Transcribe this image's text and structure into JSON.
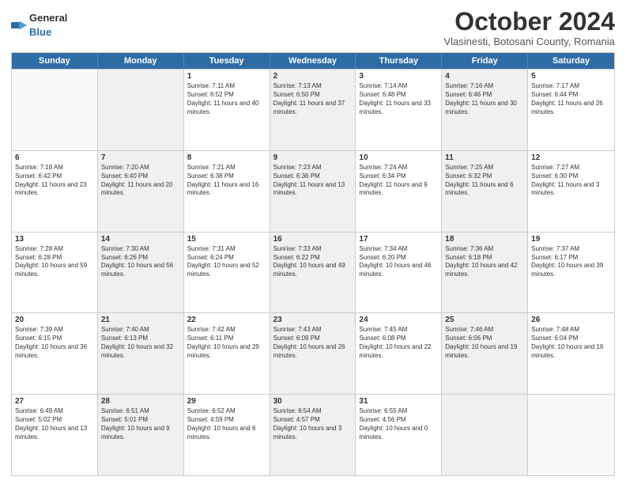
{
  "header": {
    "logo_general": "General",
    "logo_blue": "Blue",
    "month_title": "October 2024",
    "location": "Vlasinesti, Botosani County, Romania"
  },
  "days_of_week": [
    "Sunday",
    "Monday",
    "Tuesday",
    "Wednesday",
    "Thursday",
    "Friday",
    "Saturday"
  ],
  "weeks": [
    [
      {
        "day": "",
        "sunrise": "",
        "sunset": "",
        "daylight": "",
        "shaded": false,
        "empty": true
      },
      {
        "day": "",
        "sunrise": "",
        "sunset": "",
        "daylight": "",
        "shaded": true,
        "empty": true
      },
      {
        "day": "1",
        "sunrise": "Sunrise: 7:11 AM",
        "sunset": "Sunset: 6:52 PM",
        "daylight": "Daylight: 11 hours and 40 minutes.",
        "shaded": false
      },
      {
        "day": "2",
        "sunrise": "Sunrise: 7:13 AM",
        "sunset": "Sunset: 6:50 PM",
        "daylight": "Daylight: 11 hours and 37 minutes.",
        "shaded": true
      },
      {
        "day": "3",
        "sunrise": "Sunrise: 7:14 AM",
        "sunset": "Sunset: 6:48 PM",
        "daylight": "Daylight: 11 hours and 33 minutes.",
        "shaded": false
      },
      {
        "day": "4",
        "sunrise": "Sunrise: 7:16 AM",
        "sunset": "Sunset: 6:46 PM",
        "daylight": "Daylight: 11 hours and 30 minutes.",
        "shaded": true
      },
      {
        "day": "5",
        "sunrise": "Sunrise: 7:17 AM",
        "sunset": "Sunset: 6:44 PM",
        "daylight": "Daylight: 11 hours and 26 minutes.",
        "shaded": false
      }
    ],
    [
      {
        "day": "6",
        "sunrise": "Sunrise: 7:18 AM",
        "sunset": "Sunset: 6:42 PM",
        "daylight": "Daylight: 11 hours and 23 minutes.",
        "shaded": false
      },
      {
        "day": "7",
        "sunrise": "Sunrise: 7:20 AM",
        "sunset": "Sunset: 6:40 PM",
        "daylight": "Daylight: 11 hours and 20 minutes.",
        "shaded": true
      },
      {
        "day": "8",
        "sunrise": "Sunrise: 7:21 AM",
        "sunset": "Sunset: 6:38 PM",
        "daylight": "Daylight: 11 hours and 16 minutes.",
        "shaded": false
      },
      {
        "day": "9",
        "sunrise": "Sunrise: 7:23 AM",
        "sunset": "Sunset: 6:36 PM",
        "daylight": "Daylight: 11 hours and 13 minutes.",
        "shaded": true
      },
      {
        "day": "10",
        "sunrise": "Sunrise: 7:24 AM",
        "sunset": "Sunset: 6:34 PM",
        "daylight": "Daylight: 11 hours and 9 minutes.",
        "shaded": false
      },
      {
        "day": "11",
        "sunrise": "Sunrise: 7:25 AM",
        "sunset": "Sunset: 6:32 PM",
        "daylight": "Daylight: 11 hours and 6 minutes.",
        "shaded": true
      },
      {
        "day": "12",
        "sunrise": "Sunrise: 7:27 AM",
        "sunset": "Sunset: 6:30 PM",
        "daylight": "Daylight: 11 hours and 3 minutes.",
        "shaded": false
      }
    ],
    [
      {
        "day": "13",
        "sunrise": "Sunrise: 7:28 AM",
        "sunset": "Sunset: 6:28 PM",
        "daylight": "Daylight: 10 hours and 59 minutes.",
        "shaded": false
      },
      {
        "day": "14",
        "sunrise": "Sunrise: 7:30 AM",
        "sunset": "Sunset: 6:26 PM",
        "daylight": "Daylight: 10 hours and 56 minutes.",
        "shaded": true
      },
      {
        "day": "15",
        "sunrise": "Sunrise: 7:31 AM",
        "sunset": "Sunset: 6:24 PM",
        "daylight": "Daylight: 10 hours and 52 minutes.",
        "shaded": false
      },
      {
        "day": "16",
        "sunrise": "Sunrise: 7:33 AM",
        "sunset": "Sunset: 6:22 PM",
        "daylight": "Daylight: 10 hours and 49 minutes.",
        "shaded": true
      },
      {
        "day": "17",
        "sunrise": "Sunrise: 7:34 AM",
        "sunset": "Sunset: 6:20 PM",
        "daylight": "Daylight: 10 hours and 46 minutes.",
        "shaded": false
      },
      {
        "day": "18",
        "sunrise": "Sunrise: 7:36 AM",
        "sunset": "Sunset: 6:18 PM",
        "daylight": "Daylight: 10 hours and 42 minutes.",
        "shaded": true
      },
      {
        "day": "19",
        "sunrise": "Sunrise: 7:37 AM",
        "sunset": "Sunset: 6:17 PM",
        "daylight": "Daylight: 10 hours and 39 minutes.",
        "shaded": false
      }
    ],
    [
      {
        "day": "20",
        "sunrise": "Sunrise: 7:39 AM",
        "sunset": "Sunset: 6:15 PM",
        "daylight": "Daylight: 10 hours and 36 minutes.",
        "shaded": false
      },
      {
        "day": "21",
        "sunrise": "Sunrise: 7:40 AM",
        "sunset": "Sunset: 6:13 PM",
        "daylight": "Daylight: 10 hours and 32 minutes.",
        "shaded": true
      },
      {
        "day": "22",
        "sunrise": "Sunrise: 7:42 AM",
        "sunset": "Sunset: 6:11 PM",
        "daylight": "Daylight: 10 hours and 29 minutes.",
        "shaded": false
      },
      {
        "day": "23",
        "sunrise": "Sunrise: 7:43 AM",
        "sunset": "Sunset: 6:09 PM",
        "daylight": "Daylight: 10 hours and 26 minutes.",
        "shaded": true
      },
      {
        "day": "24",
        "sunrise": "Sunrise: 7:45 AM",
        "sunset": "Sunset: 6:08 PM",
        "daylight": "Daylight: 10 hours and 22 minutes.",
        "shaded": false
      },
      {
        "day": "25",
        "sunrise": "Sunrise: 7:46 AM",
        "sunset": "Sunset: 6:06 PM",
        "daylight": "Daylight: 10 hours and 19 minutes.",
        "shaded": true
      },
      {
        "day": "26",
        "sunrise": "Sunrise: 7:48 AM",
        "sunset": "Sunset: 6:04 PM",
        "daylight": "Daylight: 10 hours and 16 minutes.",
        "shaded": false
      }
    ],
    [
      {
        "day": "27",
        "sunrise": "Sunrise: 6:49 AM",
        "sunset": "Sunset: 5:02 PM",
        "daylight": "Daylight: 10 hours and 13 minutes.",
        "shaded": false
      },
      {
        "day": "28",
        "sunrise": "Sunrise: 6:51 AM",
        "sunset": "Sunset: 5:01 PM",
        "daylight": "Daylight: 10 hours and 9 minutes.",
        "shaded": true
      },
      {
        "day": "29",
        "sunrise": "Sunrise: 6:52 AM",
        "sunset": "Sunset: 4:59 PM",
        "daylight": "Daylight: 10 hours and 6 minutes.",
        "shaded": false
      },
      {
        "day": "30",
        "sunrise": "Sunrise: 6:54 AM",
        "sunset": "Sunset: 4:57 PM",
        "daylight": "Daylight: 10 hours and 3 minutes.",
        "shaded": true
      },
      {
        "day": "31",
        "sunrise": "Sunrise: 6:55 AM",
        "sunset": "Sunset: 4:56 PM",
        "daylight": "Daylight: 10 hours and 0 minutes.",
        "shaded": false
      },
      {
        "day": "",
        "sunrise": "",
        "sunset": "",
        "daylight": "",
        "shaded": true,
        "empty": true
      },
      {
        "day": "",
        "sunrise": "",
        "sunset": "",
        "daylight": "",
        "shaded": false,
        "empty": true
      }
    ]
  ]
}
